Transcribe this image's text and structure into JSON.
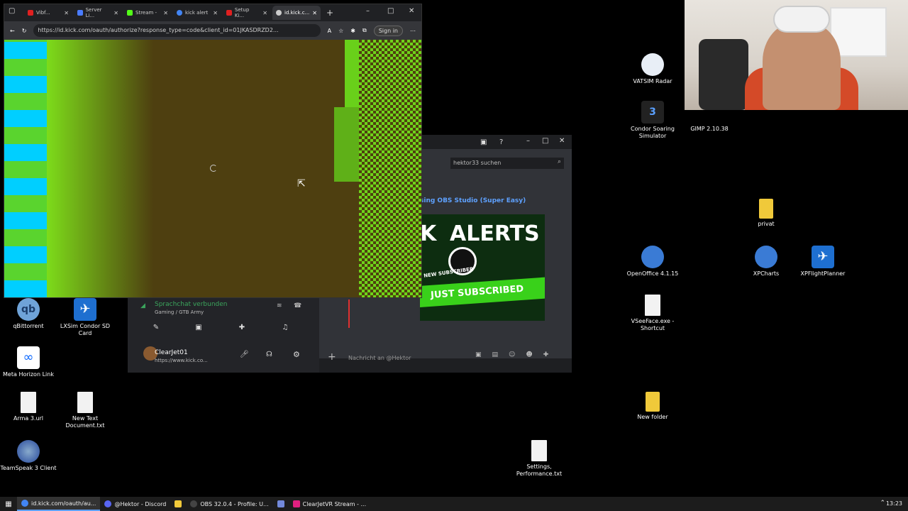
{
  "browser": {
    "tabs": [
      {
        "label": "Vibf...",
        "color": "#e02020"
      },
      {
        "label": "Server Li...",
        "color": "#4a7cff"
      },
      {
        "label": "Stream -",
        "color": "#53fc18"
      },
      {
        "label": "kick alert",
        "color": "#4285f4"
      },
      {
        "label": "Setup Ki...",
        "color": "#e02020"
      },
      {
        "label": "id.kick.c...",
        "color": "#cccccc"
      }
    ],
    "url": "https://id.kick.com/oauth/authorize?response_type=code&client_id=01JKASDRZD2...",
    "signin_label": "Sign in"
  },
  "discord": {
    "search_placeholder": "hektor33 suchen",
    "video_title": "sing OBS Studio (Super Easy)",
    "thumb_k": "K",
    "thumb_alerts": "ALERTS",
    "thumb_sub": "NEW SUBSCRIBER",
    "thumb_banner": "JUST SUBSCRIBED",
    "voice_status": "Sprachchat verbunden",
    "voice_channel": "Gaming / GTB Army",
    "username": "ClearJet01",
    "user_status": "https://www.kick.co...",
    "message_placeholder": "Nachricht an @Hektor"
  },
  "desktop_icons": [
    {
      "label": "qBittorrent",
      "type": "qbt"
    },
    {
      "label": "LXSim Condor SD Card",
      "type": "plane"
    },
    {
      "label": "Meta Horizon Link",
      "type": "meta"
    },
    {
      "label": "Arma 3.url",
      "type": "doc"
    },
    {
      "label": "New Text Document.txt",
      "type": "doc"
    },
    {
      "label": "TeamSpeak 3 Client",
      "type": "ts"
    },
    {
      "label": "VATSIM Radar",
      "type": "vatsim"
    },
    {
      "label": "Condor Soaring Simulator",
      "type": "condor"
    },
    {
      "label": "GIMP 2.10.38",
      "type": "gimp"
    },
    {
      "label": "privat",
      "type": "folder"
    },
    {
      "label": "OpenOffice 4.1.15",
      "type": "globe"
    },
    {
      "label": "XPCharts",
      "type": "globe"
    },
    {
      "label": "XPFlightPlanner",
      "type": "plane"
    },
    {
      "label": "VSeeFace.exe - Shortcut",
      "type": "doc"
    },
    {
      "label": "New folder",
      "type": "folder"
    },
    {
      "label": "Settings, Performance.txt",
      "type": "doc"
    }
  ],
  "taskbar": {
    "apps": [
      {
        "label": "id.kick.com/oauth/au...",
        "color": "#4285f4",
        "active": true
      },
      {
        "label": "@Hektor - Discord",
        "color": "#5865f2",
        "active": false
      },
      {
        "label": "",
        "color": "#f0c93a",
        "active": false
      },
      {
        "label": "OBS 32.0.4 - Profile: U...",
        "color": "#444444",
        "active": false
      },
      {
        "label": "",
        "color": "#7289da",
        "active": false
      },
      {
        "label": "ClearJetVR Stream - ...",
        "color": "#e02080",
        "active": false
      }
    ],
    "clock": "13:23"
  }
}
